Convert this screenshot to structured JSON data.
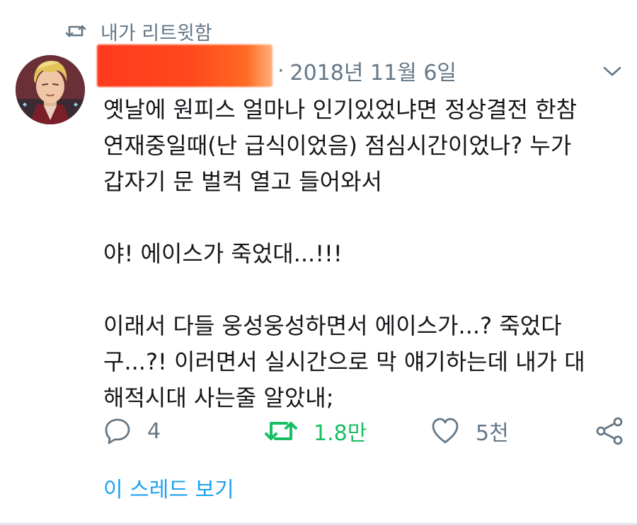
{
  "retweet_header": {
    "label": "내가 리트윗함",
    "icon": "retweet-icon"
  },
  "author": {
    "avatar_icon": "avatar",
    "name_redacted": true
  },
  "meta": {
    "separator": "·",
    "date": "2018년 11월 6일",
    "menu_icon": "chevron-down-icon"
  },
  "tweet": {
    "lines": [
      "옛날에 원피스 얼마나 인기있었냐면 정상결전 한참",
      "연재중일때(난 급식이었음) 점심시간이었나? 누가",
      "갑자기 문 벌컥 열고 들어와서",
      "",
      "야! 에이스가 죽었대...!!!",
      "",
      "이래서 다들 웅성웅성하면서 에이스가...? 죽었다",
      "구...?! 이러면서 실시간으로 막 얘기하는데 내가 대",
      "해적시대 사는줄 알았내;"
    ]
  },
  "actions": {
    "reply": {
      "icon": "reply-icon",
      "count": "4"
    },
    "retweet": {
      "icon": "retweet-icon",
      "count": "1.8만",
      "active": true,
      "color": "#17bf63"
    },
    "like": {
      "icon": "heart-icon",
      "count": "5천"
    },
    "share": {
      "icon": "share-icon"
    }
  },
  "thread_link": {
    "label": "이 스레드 보기",
    "color": "#1da1f2"
  }
}
